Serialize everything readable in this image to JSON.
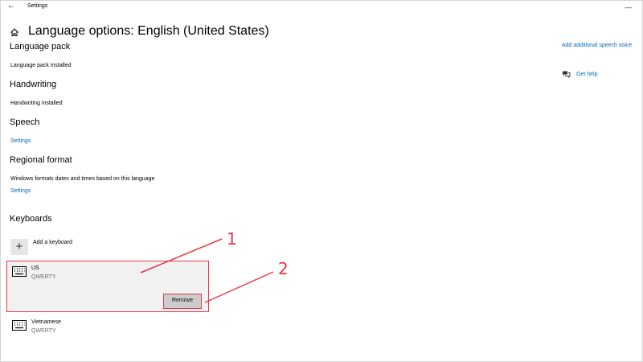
{
  "window": {
    "title": "Settings",
    "back_glyph": "←",
    "minimize_glyph": "—"
  },
  "page": {
    "title": "Language options: English (United States)"
  },
  "sections": {
    "language_pack": {
      "heading": "Language pack",
      "status": "Language pack installed"
    },
    "handwriting": {
      "heading": "Handwriting",
      "status": "Handwriting installed"
    },
    "speech": {
      "heading": "Speech",
      "settings_link": "Settings"
    },
    "regional_format": {
      "heading": "Regional format",
      "description": "Windows formats dates and times based on this language",
      "settings_link": "Settings"
    },
    "keyboards": {
      "heading": "Keyboards",
      "add_label": "Add a keyboard",
      "add_glyph": "+",
      "items": [
        {
          "name": "US",
          "layout": "QWERTY",
          "remove_label": "Remove"
        },
        {
          "name": "Vietnamese",
          "layout": "QWERTY"
        }
      ]
    }
  },
  "sidebar": {
    "speech_voice_link": "Add additional speech voice",
    "help_link": "Get help"
  },
  "annotations": {
    "one": "1",
    "two": "2",
    "color": "#e63946"
  },
  "colors": {
    "accent": "#0067c0",
    "annotation": "#e63946"
  }
}
